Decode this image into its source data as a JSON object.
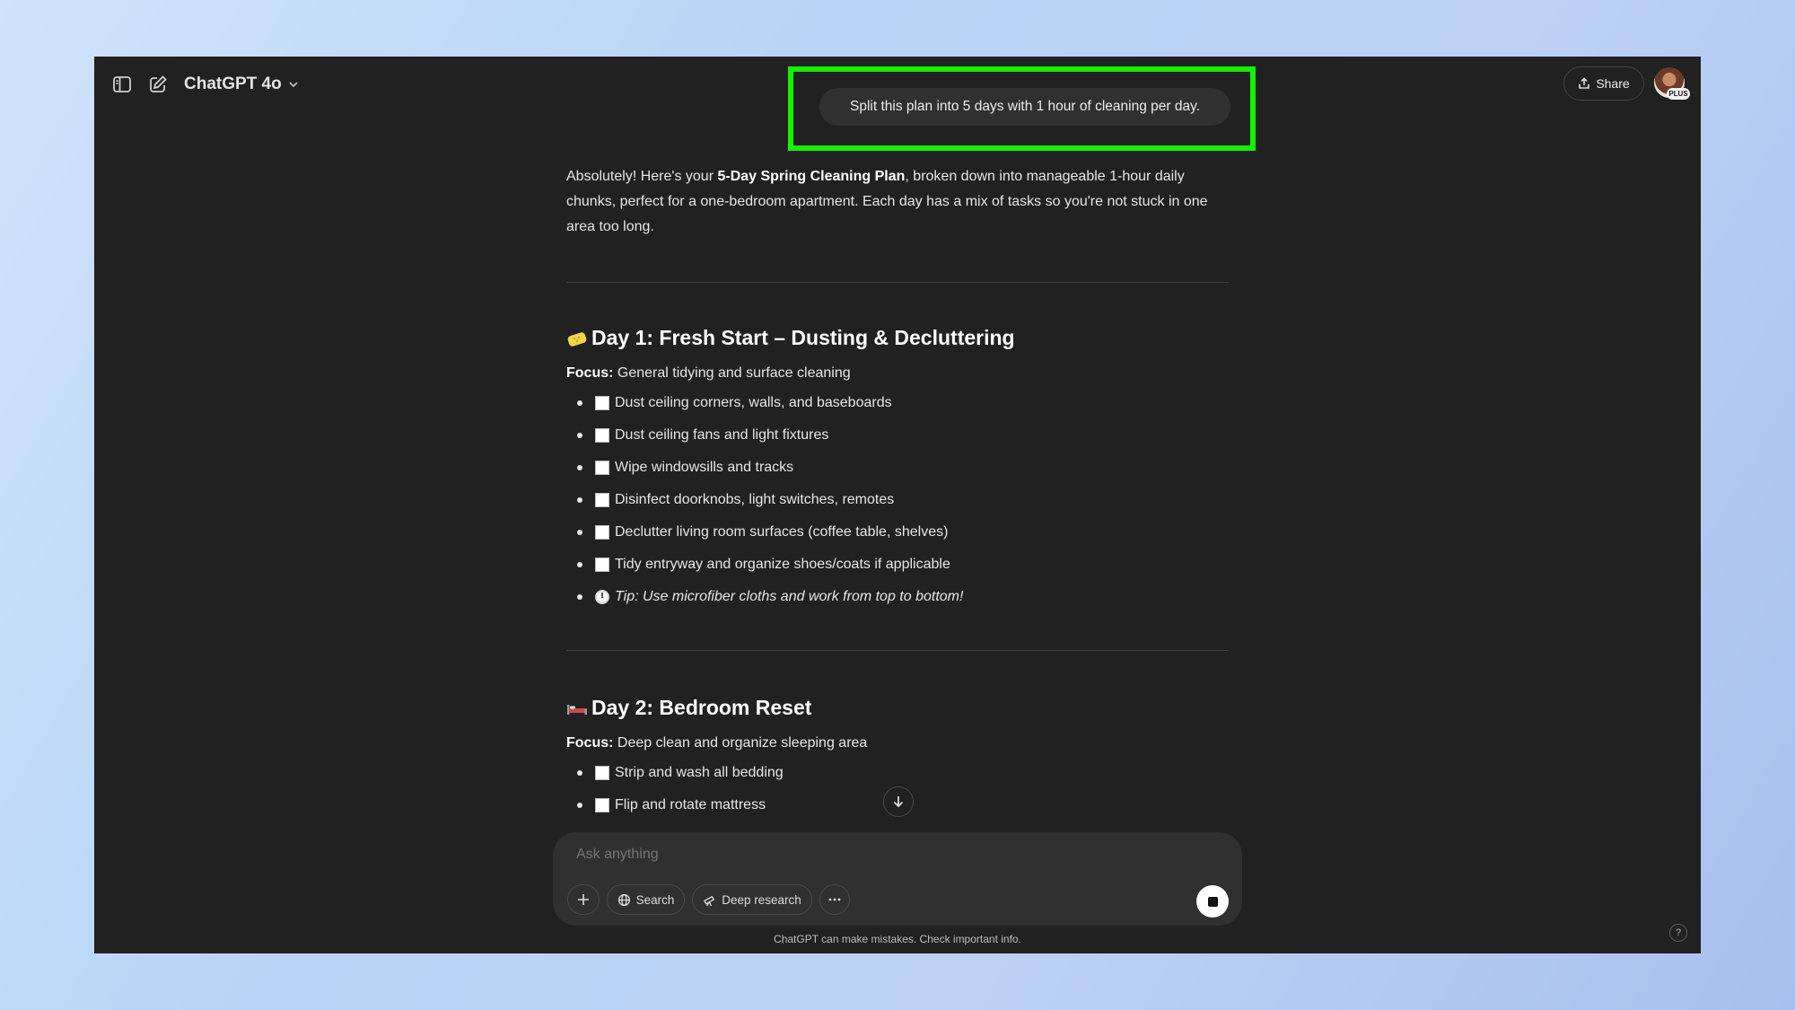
{
  "header": {
    "model_name": "ChatGPT 4o",
    "share_label": "Share",
    "plan_badge": "PLUS"
  },
  "user_message": "Split this plan into 5 days with 1 hour of cleaning per day.",
  "assistant": {
    "intro_prefix": "Absolutely! Here's your ",
    "intro_bold": "5-Day Spring Cleaning Plan",
    "intro_suffix": ", broken down into manageable 1-hour daily chunks, perfect for a one-bedroom apartment. Each day has a mix of tasks so you're not stuck in one area too long.",
    "focus_label": "Focus:",
    "days": [
      {
        "emoji": "sponge-icon",
        "title": "Day 1: Fresh Start – Dusting & Decluttering",
        "focus": " General tidying and surface cleaning",
        "tasks": [
          "Dust ceiling corners, walls, and baseboards",
          "Dust ceiling fans and light fixtures",
          "Wipe windowsills and tracks",
          "Disinfect doorknobs, light switches, remotes",
          "Declutter living room surfaces (coffee table, shelves)",
          "Tidy entryway and organize shoes/coats if applicable"
        ],
        "tip": "Tip: Use microfiber cloths and work from top to bottom!"
      },
      {
        "emoji": "bed-icon",
        "title": "Day 2: Bedroom Reset",
        "focus": " Deep clean and organize sleeping area",
        "tasks": [
          "Strip and wash all bedding",
          "Flip and rotate mattress"
        ]
      }
    ]
  },
  "composer": {
    "placeholder": "Ask anything",
    "search_label": "Search",
    "deep_research_label": "Deep research"
  },
  "footer": {
    "disclaimer": "ChatGPT can make mistakes. Check important info.",
    "help": "?"
  },
  "colors": {
    "background": "#212121",
    "highlight": "#14f000",
    "bubble": "#303030"
  }
}
